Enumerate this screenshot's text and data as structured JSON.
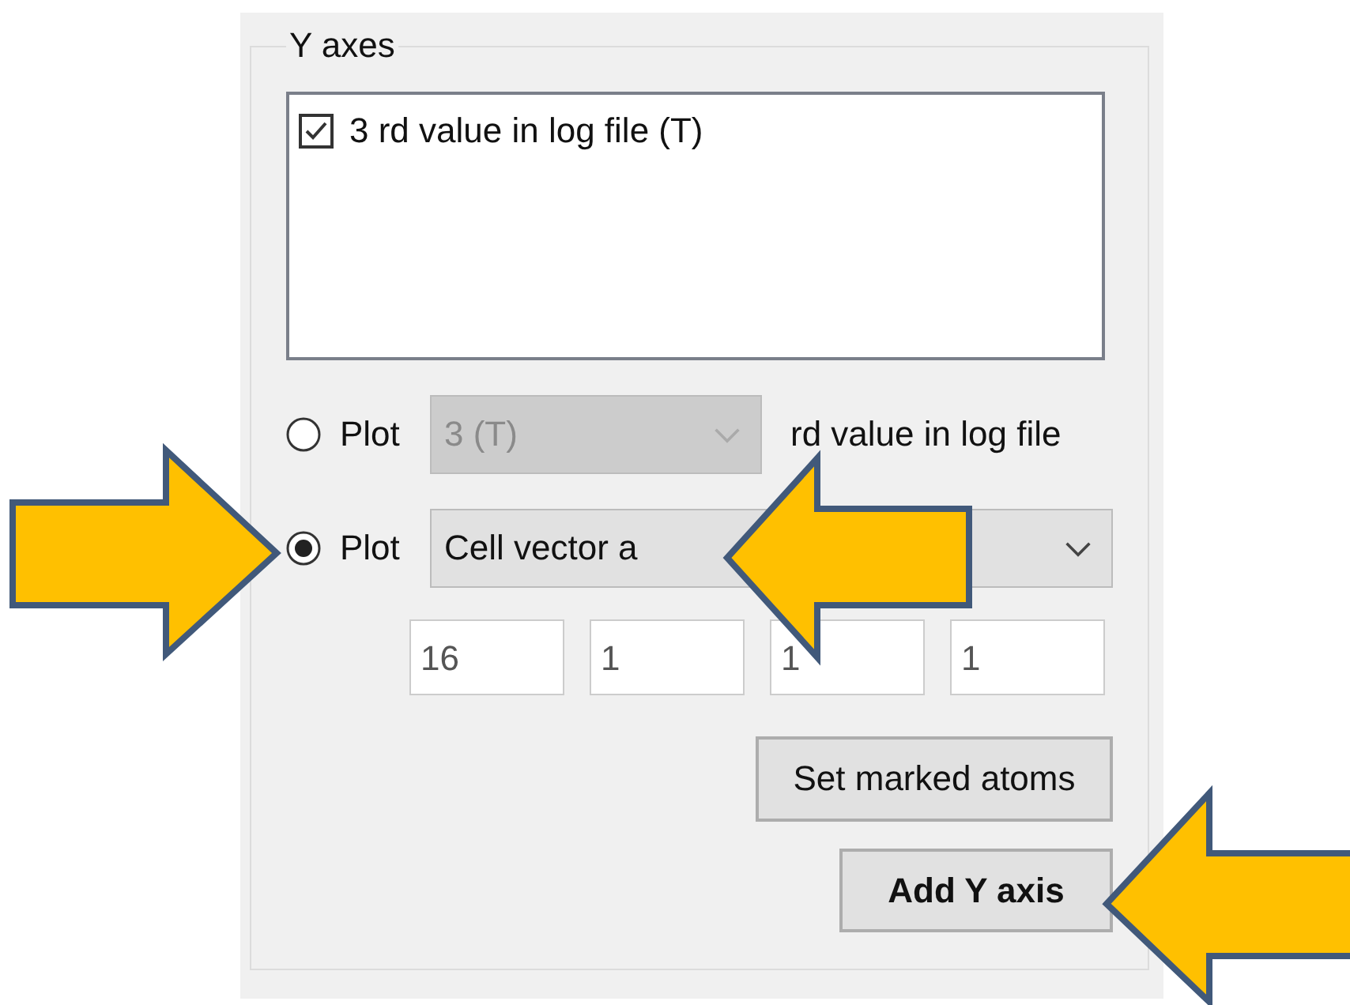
{
  "group": {
    "title": "Y axes"
  },
  "axes_list": [
    {
      "label": "3 rd value in log file (T)",
      "checked": true
    }
  ],
  "plot_options": [
    {
      "kind": "column",
      "selected": false,
      "label": "Plot",
      "combo": {
        "value": "3 (T)",
        "disabled": true
      },
      "suffix": "rd value in log file"
    },
    {
      "kind": "quantity",
      "selected": true,
      "label": "Plot",
      "combo": {
        "value": "Cell vector a",
        "disabled": false
      }
    }
  ],
  "atom_fields": [
    "16",
    "1",
    "1",
    "1"
  ],
  "buttons": [
    {
      "label": "Set marked atoms",
      "default": false
    },
    {
      "label": "Add Y axis",
      "default": true
    }
  ]
}
